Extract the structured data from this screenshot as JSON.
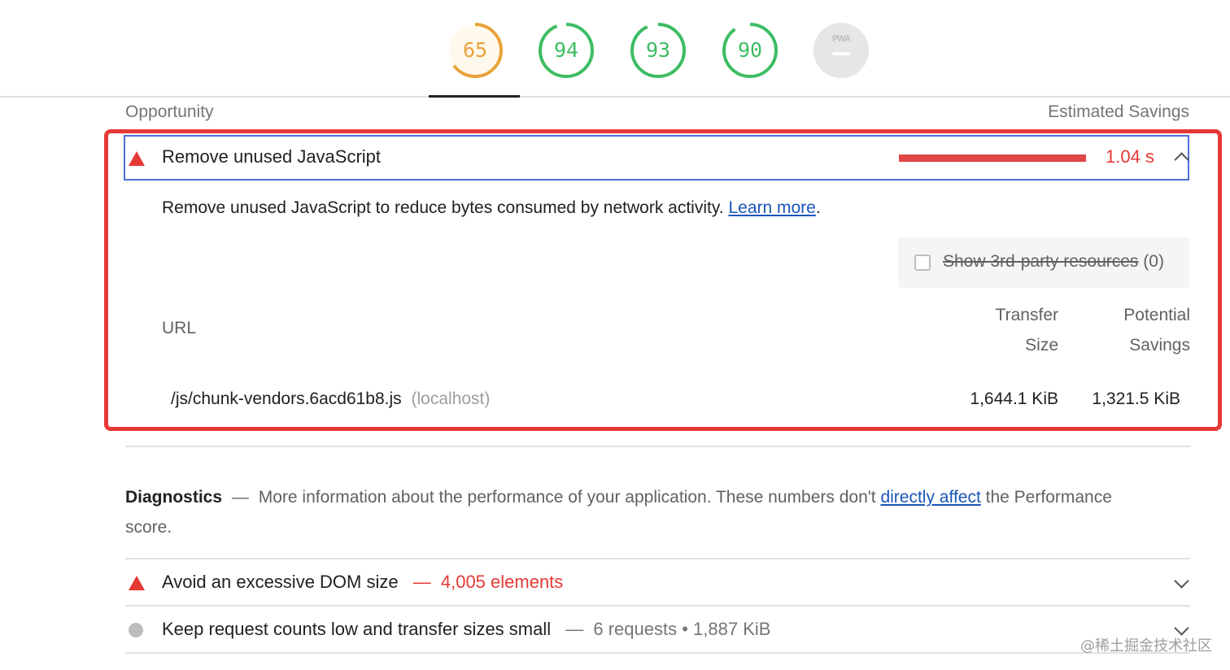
{
  "scores": [
    {
      "value": "65",
      "fraction": 0.65,
      "color": "#e8a33a",
      "fill": "#fff8ec"
    },
    {
      "value": "94",
      "fraction": 0.94,
      "color": "#3dbd63",
      "fill": "#ffffff"
    },
    {
      "value": "93",
      "fraction": 0.93,
      "color": "#3dbd63",
      "fill": "#ffffff"
    },
    {
      "value": "90",
      "fraction": 0.9,
      "color": "#3dbd63",
      "fill": "#ffffff"
    }
  ],
  "pwa": {
    "label": "PWA"
  },
  "table_header": {
    "left": "Opportunity",
    "right": "Estimated Savings"
  },
  "opportunity": {
    "title": "Remove unused JavaScript",
    "savings": "1.04 s",
    "description": "Remove unused JavaScript to reduce bytes consumed by network activity.",
    "learn_more": "Learn more",
    "period": ".",
    "third_party_label": "Show 3rd-party resources",
    "third_party_count": "(0)",
    "columns": {
      "url": "URL",
      "transfer_size": [
        "Transfer",
        "Size"
      ],
      "potential_savings": [
        "Potential",
        "Savings"
      ]
    },
    "rows": [
      {
        "url": "/js/chunk-vendors.6acd61b8.js",
        "host": "(localhost)",
        "transfer": "1,644.1 KiB",
        "savings": "1,321.5 KiB"
      }
    ]
  },
  "diagnostics": {
    "title": "Diagnostics",
    "dash": "—",
    "text_before": "More information about the performance of your application. These numbers don't",
    "link": "directly affect",
    "text_after": "the Performance score.",
    "items": [
      {
        "title": "Avoid an excessive DOM size",
        "dash": "—",
        "detail": "4,005 elements",
        "status": "fail"
      },
      {
        "title": "Keep request counts low and transfer sizes small",
        "dash": "—",
        "detail": "6 requests • 1,887 KiB",
        "status": "info"
      }
    ]
  },
  "colors": {
    "fail": "#e53935",
    "pass": "#3dbd63",
    "average": "#e8a33a",
    "link": "#1a55b8",
    "highlight": "#e53935"
  },
  "watermark": "@稀土掘金技术社区"
}
